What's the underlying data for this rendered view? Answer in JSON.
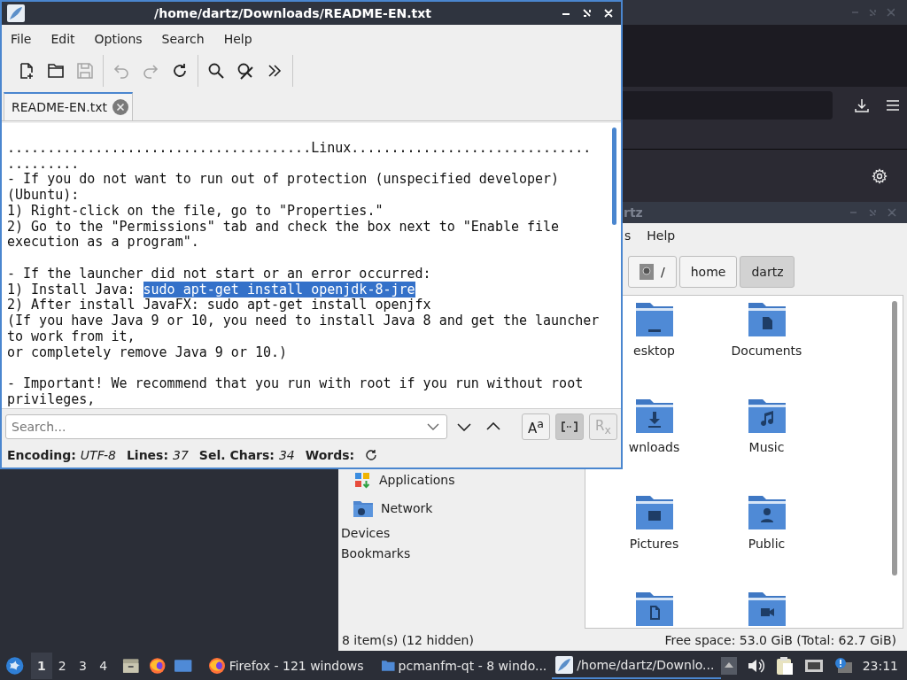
{
  "editor": {
    "title": "/home/dartz/Downloads/README-EN.txt",
    "menu": [
      "File",
      "Edit",
      "Options",
      "Search",
      "Help"
    ],
    "toolbar_groups": [
      {
        "buttons": [
          {
            "kind": "new",
            "disabled": false
          },
          {
            "kind": "open",
            "disabled": false
          },
          {
            "kind": "save",
            "disabled": true
          }
        ]
      },
      {
        "buttons": [
          {
            "kind": "undo",
            "disabled": true
          },
          {
            "kind": "redo",
            "disabled": true
          },
          {
            "kind": "reload",
            "disabled": false
          }
        ]
      },
      {
        "buttons": [
          {
            "kind": "find",
            "disabled": false
          },
          {
            "kind": "replace",
            "disabled": false
          },
          {
            "kind": "more",
            "disabled": false
          }
        ]
      }
    ],
    "tabs": [
      {
        "label": "README-EN.txt",
        "selected": true
      }
    ],
    "text_blocks": [
      {
        "lines": [
          {
            "text": "......................................Linux.............................."
          },
          {
            "text": "........."
          },
          {
            "text": "- If you do not want to run out of protection (unspecified developer)"
          },
          {
            "text": "(Ubuntu):"
          },
          {
            "text": "1) Right-click on the file, go to \"Properties.\""
          },
          {
            "text": "2) Go to the \"Permissions\" tab and check the box next to \"Enable file"
          },
          {
            "text": "execution as a program\"."
          }
        ]
      },
      {
        "lines": [
          {
            "text": "- If the launcher did not start or an error occurred:"
          },
          {
            "text": "1) Install Java: ",
            "selection": "sudo apt-get install openjdk-8-jre"
          },
          {
            "text": "2) After install JavaFX: sudo apt-get install openjfx"
          },
          {
            "text": "(If you have Java 9 or 10, you need to install Java 8 and get the launcher"
          },
          {
            "text": "to work from it,"
          },
          {
            "text": "or completely remove Java 9 or 10.)"
          }
        ]
      },
      {
        "lines": [
          {
            "text": "- Important! We recommend that you run with root if you run without root"
          },
          {
            "text": "privileges,"
          }
        ]
      }
    ],
    "search": {
      "placeholder": "Search..."
    },
    "find_options": [
      {
        "kind": "match-case",
        "label": "A$^{a}$",
        "selected": false,
        "disabled": false
      },
      {
        "kind": "whole-word",
        "selected": true,
        "disabled": false
      },
      {
        "kind": "regex",
        "label": "R$_{x}$",
        "selected": false,
        "disabled": true
      }
    ],
    "status": [
      {
        "label": "Encoding:",
        "value": "UTF-8"
      },
      {
        "label": "Lines:",
        "value": "37"
      },
      {
        "label": "Sel. Chars:",
        "value": "34"
      },
      {
        "label": "Words:"
      }
    ]
  },
  "file_manager": {
    "title": "rtz",
    "menu": [
      "s",
      "Help"
    ],
    "path": [
      {
        "label": "/",
        "kind": "root",
        "selected": false
      },
      {
        "label": "home",
        "selected": false
      },
      {
        "label": "dartz",
        "selected": true
      }
    ],
    "places": [
      {
        "label": "Applications",
        "kind": "applications"
      },
      {
        "label": "Network",
        "kind": "network"
      }
    ],
    "sections": [
      "Devices",
      "Bookmarks"
    ],
    "files": [
      {
        "name": "esktop",
        "kind": "desktop"
      },
      {
        "name": "Documents",
        "kind": "documents"
      },
      {
        "name": "wnloads",
        "kind": "downloads"
      },
      {
        "name": "Music",
        "kind": "music"
      },
      {
        "name": "Pictures",
        "kind": "pictures"
      },
      {
        "name": "Public",
        "kind": "public"
      },
      {
        "kind": "templates"
      },
      {
        "kind": "videos"
      }
    ],
    "status_left": "8 item(s) (12 hidden)",
    "status_right": "Free space: 53.0 GiB (Total: 62.7 GiB)"
  },
  "taskbar": {
    "workspaces": [
      {
        "label": "1",
        "selected": true
      },
      {
        "label": "2",
        "selected": false
      },
      {
        "label": "3",
        "selected": false
      },
      {
        "label": "4",
        "selected": false
      }
    ],
    "tasks": [
      {
        "label": "Firefox - 121 windows",
        "kind": "browser",
        "selected": false
      },
      {
        "label": "pcmanfm-qt - 8 windo...",
        "kind": "folder",
        "selected": false
      },
      {
        "label": "/home/dartz/Downlo...",
        "kind": "editor",
        "selected": true
      }
    ],
    "clock": "23:11"
  }
}
